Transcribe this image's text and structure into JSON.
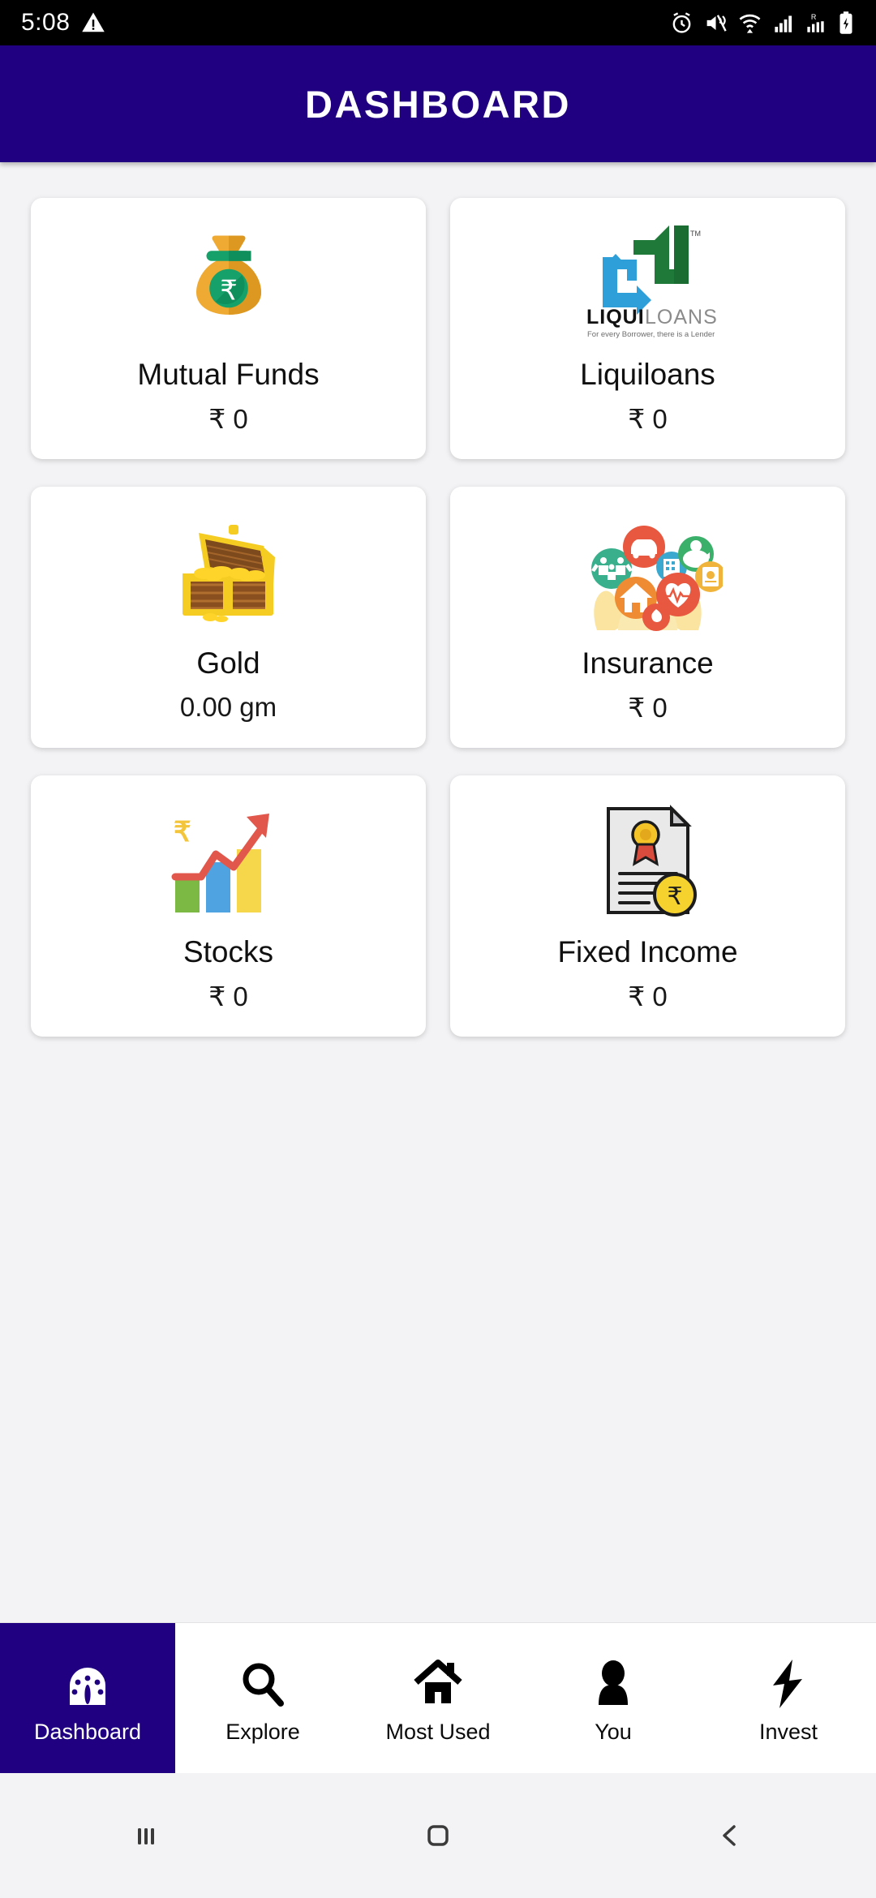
{
  "status_bar": {
    "time": "5:08",
    "left_icons": [
      "warning-triangle-icon"
    ],
    "right_icons": [
      "alarm-icon",
      "volume-mute-icon",
      "wifi-icon",
      "signal-bars-icon",
      "roaming-signal-icon",
      "battery-charging-icon"
    ]
  },
  "header": {
    "title": "DASHBOARD",
    "background_color": "#200080",
    "text_color": "#ffffff"
  },
  "cards": [
    {
      "id": "mutual-funds",
      "label": "Mutual Funds",
      "value": "₹ 0",
      "icon": "money-bag-icon"
    },
    {
      "id": "liquiloans",
      "label": "Liquiloans",
      "value": "₹ 0",
      "icon": "liquiloans-logo-icon",
      "logo": {
        "word_bold": "LIQUI",
        "word_light": "LOANS",
        "trademark": "TM",
        "tagline": "For every Borrower, there is a Lender"
      }
    },
    {
      "id": "gold",
      "label": "Gold",
      "value": "0.00 gm",
      "icon": "treasure-chest-icon"
    },
    {
      "id": "insurance",
      "label": "Insurance",
      "value": "₹ 0",
      "icon": "insurance-hands-icon"
    },
    {
      "id": "stocks",
      "label": "Stocks",
      "value": "₹ 0",
      "icon": "stocks-growth-chart-icon"
    },
    {
      "id": "fixed-income",
      "label": "Fixed Income",
      "value": "₹ 0",
      "icon": "certificate-rupee-icon"
    }
  ],
  "bottom_nav": {
    "active_index": 0,
    "active_color": "#200080",
    "items": [
      {
        "id": "dashboard",
        "label": "Dashboard",
        "icon": "speedometer-icon"
      },
      {
        "id": "explore",
        "label": "Explore",
        "icon": "search-icon"
      },
      {
        "id": "most-used",
        "label": "Most Used",
        "icon": "home-icon"
      },
      {
        "id": "you",
        "label": "You",
        "icon": "person-icon"
      },
      {
        "id": "invest",
        "label": "Invest",
        "icon": "lightning-bolt-icon"
      }
    ]
  },
  "system_nav": {
    "items": [
      {
        "id": "recents",
        "icon": "recents-icon"
      },
      {
        "id": "home",
        "icon": "home-square-icon"
      },
      {
        "id": "back",
        "icon": "back-chevron-icon"
      }
    ]
  }
}
